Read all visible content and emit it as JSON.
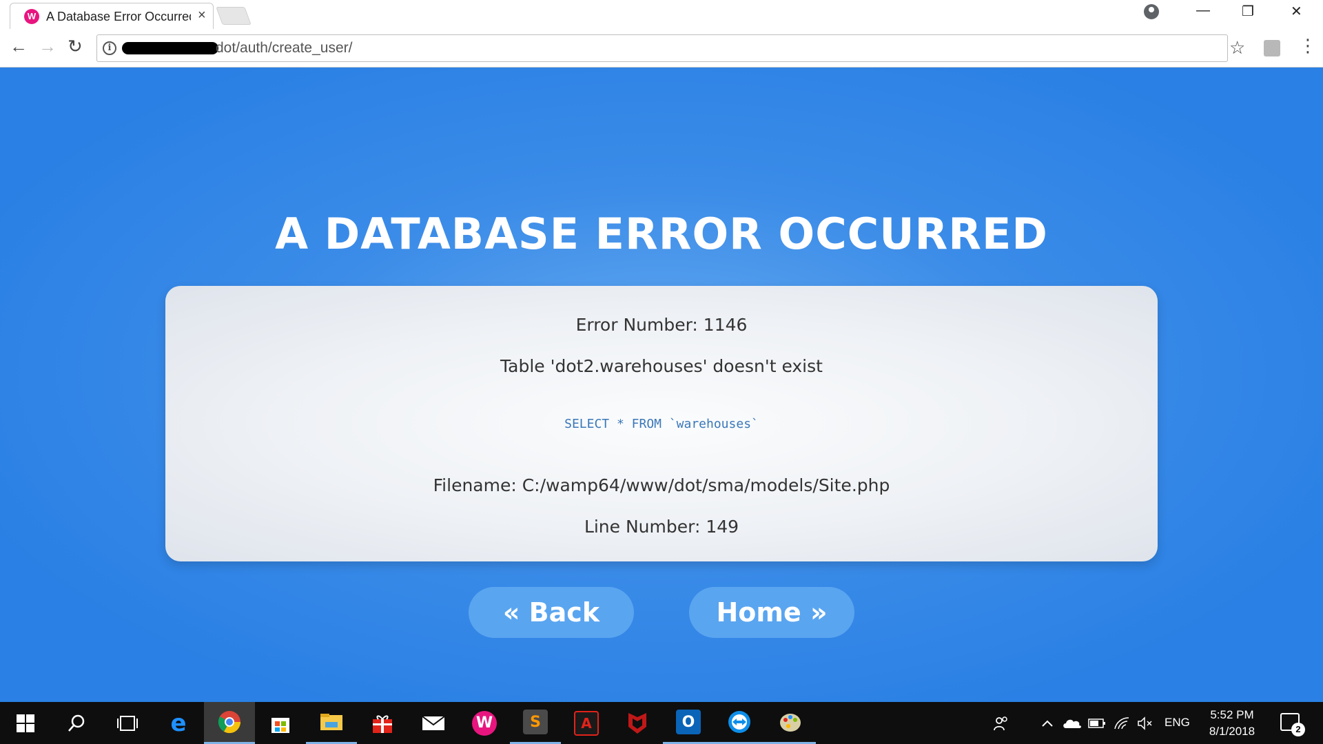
{
  "browser": {
    "tab_title": "A Database Error Occurred",
    "tab_favicon_letter": "W",
    "close_glyph": "×",
    "url_visible": "dot/auth/create_user/",
    "info_glyph": "i",
    "back_glyph": "←",
    "forward_glyph": "→",
    "reload_glyph": "↻",
    "star_glyph": "☆",
    "menu_glyph": "⋮",
    "minimize_glyph": "—",
    "restore_glyph": "❐",
    "window_close_glyph": "✕"
  },
  "error_page": {
    "heading": "A DATABASE ERROR OCCURRED",
    "error_number": "Error Number: 1146",
    "message": "Table 'dot2.warehouses' doesn't exist",
    "sql": "SELECT * FROM `warehouses`",
    "filename": "Filename: C:/wamp64/www/dot/sma/models/Site.php",
    "line_number": "Line Number: 149",
    "back_button": "« Back",
    "home_button": "Home »"
  },
  "taskbar": {
    "apps": [
      "start-icon",
      "search-icon",
      "task-view-icon",
      "edge-icon",
      "chrome-icon",
      "store-icon",
      "file-explorer-icon",
      "gift-icon",
      "mail-icon",
      "wamp-icon",
      "sublime-text-icon",
      "acrobat-icon",
      "mcafee-icon",
      "outlook-icon",
      "teamviewer-icon",
      "paint-icon"
    ],
    "language": "ENG",
    "time": "5:52 PM",
    "date": "8/1/2018",
    "notification_count": "2"
  },
  "colors": {
    "page_blue": "#2d82e3",
    "button_blue": "#5aa5f0",
    "sql_blue": "#3a77b8"
  }
}
